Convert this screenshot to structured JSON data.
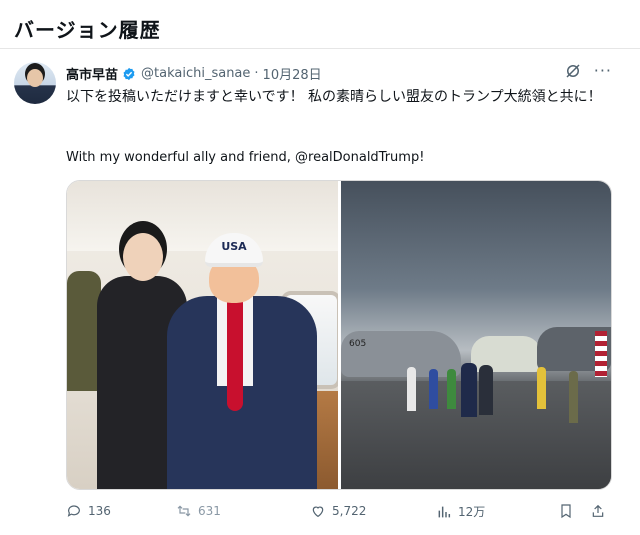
{
  "page": {
    "title": "バージョン履歴"
  },
  "post": {
    "author_name": "高市早苗",
    "author_handle": "@takaichi_sanae",
    "separator": "·",
    "date": "10月28日",
    "text_jp": "以下を投稿いただけますと幸いです！ 私の素晴らしい盟友のトランプ大統領と共に！",
    "text_en": "With my wonderful ally and friend, @realDonaldTrump!",
    "more_label": "···",
    "cap_text": "USA",
    "jet_number": "605"
  },
  "stats": {
    "replies": "136",
    "reposts": "631",
    "likes": "5,722",
    "views": "12万"
  },
  "icons": [
    "verified-badge-icon",
    "grok-icon",
    "more-icon",
    "reply-icon",
    "repost-icon",
    "like-icon",
    "views-icon",
    "bookmark-icon",
    "share-icon"
  ],
  "colors": {
    "verified": "#1d9bf0",
    "text": "#0f1419",
    "muted": "#536471",
    "divider": "#e6e6e6"
  }
}
